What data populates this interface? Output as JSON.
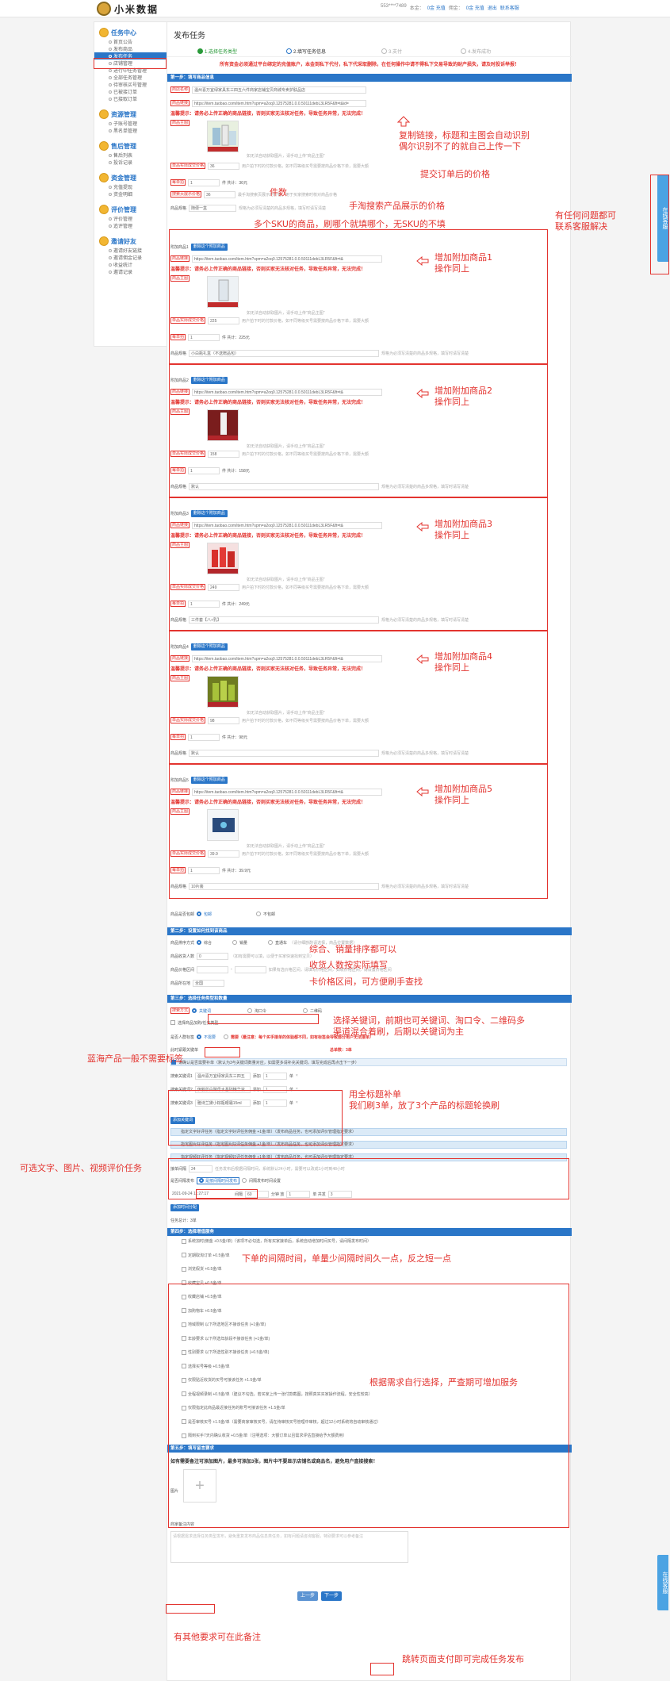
{
  "app": {
    "logo_text": "小米数据"
  },
  "header": {
    "items": [
      "553****7489",
      "本金：",
      "0金 充值",
      "佣金：",
      "0金 充值",
      "退出",
      "联系客服"
    ]
  },
  "sidebar": {
    "groups": [
      {
        "label": "任务中心",
        "items": [
          "首页公告",
          "发布商品",
          "发布任务",
          "店铺管理",
          "进行中任务管理",
          "全部任务管理",
          "待审核买号管理",
          "已被接订单",
          "已接取订单"
        ]
      },
      {
        "label": "资源管理",
        "items": [
          "子账号管理",
          "黑名单管理"
        ]
      },
      {
        "label": "售后管理",
        "items": [
          "售后列表",
          "投诉记录"
        ]
      },
      {
        "label": "资金管理",
        "items": [
          "充值提现",
          "资金明细"
        ]
      },
      {
        "label": "评价管理",
        "items": [
          "评价管理",
          "追评管理"
        ]
      },
      {
        "label": "邀请好友",
        "items": [
          "邀请好友链接",
          "邀请佣金记录",
          "收益统计",
          "邀请记录"
        ]
      }
    ]
  },
  "page": {
    "title": "发布任务",
    "steps": [
      "1.选择任务类型",
      "2.填写任务信息",
      "3.支付",
      "4.发布成功"
    ],
    "warning": "所有资金必须通过平台绑定的充值账户，本金到私下代付，私下代采取删除，在任何操作中请不得私下交易导致的财产损失，请及时投诉举报！"
  },
  "section1": {
    "bar": "第一步：填写商品信息",
    "shop_label": "商店名称",
    "shop_value": "温州喜万宜绿家具东三四五六件商家店铺宝贝商城专卖护肤品店",
    "link_label": "商品链接",
    "link_value": "https://item.taobao.com/item.htm?spm=a2oq0.12575281.0.0.50111debL3LR5F&ft=t&id=",
    "warn": "温馨提示：请务必上传正确的商品链接，否则买家无法核对任务，导致任务异常，无法完成！",
    "img_label": "商品主图",
    "img_hint": "如无法自动获取图片，请手动上传\"商品主图\"",
    "price_label": "单品实际成交价格",
    "price_value": "36",
    "price_hint": "用户拍下时的付款价格，如不同等级买号需要按商品价格下单，需要大额",
    "qty_label": "每单拍",
    "qty_value": "1",
    "qty_total": "件 共计：36元",
    "search_price_label": "搜索页展示价格",
    "search_price_value": "36",
    "search_price_hint": "最手淘搜索页展示的价格，用于买家搜索时核对商品价格",
    "spec_label": "商品规格",
    "spec_value": "随便一盒",
    "spec_hint": "规格为必须写清楚的商品多规格，填写时请写清楚"
  },
  "addons": [
    {
      "title": "附加商品1",
      "del": "删除这个附加商品",
      "link": "https://item.taobao.com/item.htm?spm=a2oq0.12575281.0.0.50111debL3LR5F&ft=t&",
      "warn": "温馨提示：请务必上传正确的商品链接，否则买家无法核对任务，导致任务异常，无法完成！",
      "price": "225",
      "qty": "1",
      "total": "件 共计：225元",
      "spec": "小白瓶礼盒（不送赠品包）",
      "spec_hint": "规格为必须写清楚的商品多规格，填写时请写清楚"
    },
    {
      "title": "附加商品2",
      "del": "删除这个附加商品",
      "link": "https://item.taobao.com/item.htm?spm=a2oq0.12575281.0.0.50111debL3LR5F&ft=t&",
      "warn": "温馨提示：请务必上传正确的商品链接，否则买家无法核对任务，导致任务异常，无法完成！",
      "price": "158",
      "qty": "1",
      "total": "件 共计：158元",
      "spec": "默认",
      "spec_hint": "规格为必须写清楚的商品多规格，填写时请写清楚"
    },
    {
      "title": "附加商品3",
      "del": "删除这个附加商品",
      "link": "https://item.taobao.com/item.htm?spm=a2oq0.12575281.0.0.50111debL3LR5F&ft=t&",
      "warn": "温馨提示：请务必上传正确的商品链接，否则买家无法核对任务，导致任务异常，无法完成！",
      "price": "249",
      "qty": "1",
      "total": "件 共计：249元",
      "spec": "三件套【八+乳】",
      "spec_hint": "规格为必须写清楚的商品多规格，填写时请写清楚"
    },
    {
      "title": "附加商品4",
      "del": "删除这个附加商品",
      "link": "https://item.taobao.com/item.htm?spm=a2oq0.12575281.0.0.50111debL3LR5F&ft=t&",
      "warn": "温馨提示：请务必上传正确的商品链接，否则买家无法核对任务，导致任务异常，无法完成！",
      "price": "98",
      "qty": "1",
      "total": "件 共计：98元",
      "spec": "默认",
      "spec_hint": "规格为必须写清楚的商品多规格，填写时请写清楚"
    },
    {
      "title": "附加商品5",
      "del": "删除这个附加商品",
      "link": "https://item.taobao.com/item.htm?spm=a2oq0.12575281.0.0.50111debL3LR5F&ft=t&",
      "warn": "温馨提示：请务必上传正确的商品链接，否则买家无法核对任务，导致任务异常，无法完成！",
      "price": "39.9",
      "qty": "1",
      "total": "件 共计：39.9元",
      "spec": "10片装",
      "spec_hint": "规格为必须写清楚的商品多规格，填写时请写清楚"
    }
  ],
  "common": {
    "link_label": "商品链接",
    "img_label": "商品主图",
    "img_hint": "如无法自动获取图片，请手动上传\"商品主图\"",
    "price_label": "单品实际成交价格",
    "price_hint": "用户拍下时的付款价格，如不同等级买号需要按商品价格下单，需要大额",
    "qty_label": "每单拍",
    "spec_label": "商品规格"
  },
  "shipping": {
    "label": "商品是否包邮",
    "opt1": "包邮",
    "opt2": "不包邮"
  },
  "section2": {
    "bar": "第二步：设置如何找到该商品",
    "sort_label": "商品排序方式",
    "sort_opts": [
      "综合",
      "销量",
      "直通车"
    ],
    "sort_hint": "（请仔细斟酌请选择，商品位置数据）",
    "buyers_label": "商品收货人数",
    "buyers_value": "0",
    "buyers_hint": "（如有需要可以填，以便于买家快速找到宝贝）",
    "range_label": "商品价格区间",
    "range_hint": "如果有选价格区间，请填写价格区间，如收价格区间，请设置价格区间",
    "loc_label": "商品所在地",
    "loc_value": "全国"
  },
  "section3": {
    "bar": "第三步：选择任务类型和数量",
    "type_label": "搜索方式",
    "type_opts": [
      "关键词",
      "淘口令",
      "二维码"
    ],
    "opt_label": "选择商品加购/任务类型",
    "tag_label": "是否人群标签",
    "tag_opt": "不需要",
    "tag_note": "需要（最注意：每个买手接单的体验都不同，如有标签会导致部分用户无法接单）",
    "count_label": "此时紧跟关键单",
    "count_hint": "总单数：3单",
    "check_warn": "请确认是否需要补单（默认为3与关键词数量对应，如需更多请补充关键词，填写完成后再点击下一步）",
    "kw": [
      {
        "label": "搜索关键词1",
        "value": "温州喜万宜绿家具东三四五",
        "qty": "1"
      },
      {
        "label": "搜索关键词2",
        "value": "伊丽莎白酵母水基础精华液",
        "qty": "1"
      },
      {
        "label": "搜索关键词3",
        "value": "雅诗兰黛小棕瓶眼霜15ml",
        "qty": "1"
      }
    ],
    "kw_add": "添加",
    "kw_unit": "单",
    "add_kw_btn": "添加关键词",
    "review_tags": [
      "指定文字好评任务（指定文字好评任务佣金 +1金/单）（发布商品任务，也可添加评价管理指定要求）",
      "指定图片好评任务（指定图片好评任务佣金 +1金/单）（发布商品任务，也可添加评价管理指定要求）",
      "指定视频好评任务（指定视频好评任务佣金 +1金/单）（发布商品任务，也可添加评价管理指定要求）"
    ],
    "interval_label": "接单间隔",
    "interval_value": "24",
    "interval_hint": "任务发布后根据间隔时间，系统默认24小时，需要可以改成1小时到48小时",
    "publish_label": "是否间隔发布",
    "publish_opt1": "是按间隔时间发布",
    "publish_opt2": "间隔发布时间设置",
    "time_value": "2021-09-24 11:27:17",
    "time_label1": "间隔",
    "time_v1": "60",
    "time_label2": "分钟 放",
    "time_v2": "1",
    "time_label3": "单 共发",
    "time_v3": "3",
    "split_btn": "添加时间分配",
    "total_label": "任务总计：3单"
  },
  "section4": {
    "bar": "第四步：选择增值服务",
    "services": [
      "系统加时(佣金 +0.5金/单)（该项不必勾选，所有买家接单后，系统自动增加时间买号，请间隔发布时间）",
      "定期取淘订单 +0.5金/单",
      "浏览假货 +0.5金/单",
      "收藏宝贝 +0.5金/单",
      "收藏店铺 +0.5金/单",
      "加购物车 +0.5金/单",
      "地域限制 以下所选地区不接该任务 (+1金/单)",
      "年龄要求 以下所选年龄段不接该任务 (+1金/单)",
      "性别要求 以下所选性别不接该任务 (+0.5金/单)",
      "选择买号等级 +0.5金/单",
      "仅限贴近收货的买号可接该任务 +1.5金/单",
      "全程视频录制 +0.5金/单（建议不勾选，若买家上传一张付款截图，按照真实买家操作流程，安全性较高）",
      "仅限指定此商品最近接任务的账号可接该任务 +1.5金/单",
      "是否审核买号 +1.5金/单（需要商家审核买号，请在待审核买号管理中审核，超过12小时系统将自动审核通过）",
      "隔到买手7天内确认收货 +0.5金/单（注明选项：大额订单以且需求评估直接给予大额费用）"
    ]
  },
  "section5": {
    "bar": "第五步：填写留言要求",
    "notice": "如有需要备注可添加图片，最多可添加3张，图片中不要显示店铺名或商品名，避免用户直接搜索！",
    "img_label": "图片",
    "note_label": "商家备注内容",
    "note_placeholder": "请根据需求选择任务类型发布，避免重复发布商品信息类任务，如有问题请咨询客服，特别要求可以参考备注"
  },
  "footer": {
    "prev": "上一步",
    "next": "下一步"
  },
  "kefu": {
    "label": "在线客服"
  },
  "annotations": {
    "a1": "复制链接，标题和主图会自动识别\n偶尔识别不了的就自己上传一下",
    "a2": "提交订单后的价格",
    "a3": "件数",
    "a4": "手淘搜索产品展示的价格",
    "a5": "多个SKU的商品，刷哪个就填哪个，无SKU的不填",
    "a6": "有任何问题都可\n联系客服解决",
    "add1": "增加附加商品1\n操作同上",
    "add2": "增加附加商品2\n操作同上",
    "add3": "增加附加商品3\n操作同上",
    "add4": "增加附加商品4\n操作同上",
    "add5": "增加附加商品5\n操作同上",
    "a7": "综合、销量排序都可以",
    "a8": "收货人数按实际填写",
    "a9": "卡价格区间，可方便刷手查找",
    "a10": "选择关键词，前期也可关键词、淘口令、二维码多\n渠道混合着刷，后期以关键词为主",
    "a11": "蓝海产品一般不需要标签",
    "a12": "用全标题补单\n我们刷3单，放了3个产品的标题轮换刷",
    "a13": "可选文字、图片、视频评价任务",
    "a14": "下单的间隔时间，单量少间隔时间久一点，反之短一点",
    "a15": "根据需求自行选择，严查期可增加服务",
    "a16": "有其他要求可在此备注",
    "a17": "跳转页面支付即可完成任务发布"
  },
  "colors": {
    "accent": "#2a76c8",
    "annotation": "#e3342f",
    "success": "#2a9a3a"
  }
}
